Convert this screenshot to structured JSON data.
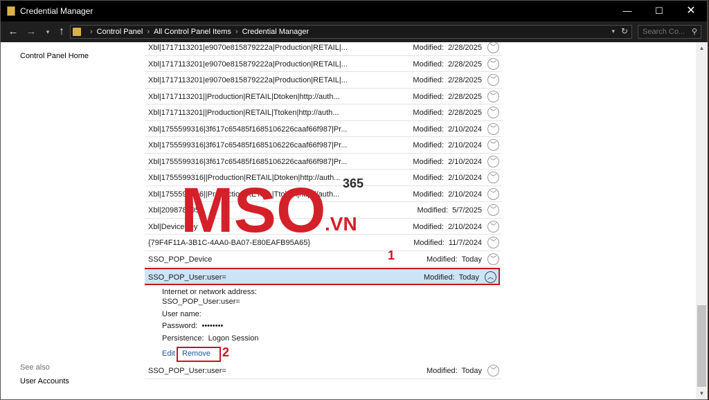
{
  "window": {
    "title": "Credential Manager",
    "controls": {
      "minimize": "—",
      "maximize": "☐",
      "close": "✕"
    }
  },
  "address": {
    "crumbs": [
      "Control Panel",
      "All Control Panel Items",
      "Credential Manager"
    ],
    "search_placeholder": "Search Co..."
  },
  "leftnav": {
    "home": "Control Panel Home",
    "see_also": "See also",
    "user_accounts": "User Accounts"
  },
  "list": {
    "modified_label": "Modified:",
    "items": [
      {
        "name": "Xbl|1717113201|e9070e815879222a|Production|RETAIL|...",
        "date": "2/28/2025"
      },
      {
        "name": "Xbl|1717113201|e9070e815879222a|Production|RETAIL|...",
        "date": "2/28/2025"
      },
      {
        "name": "Xbl|1717113201|e9070e815879222a|Production|RETAIL|...",
        "date": "2/28/2025"
      },
      {
        "name": "Xbl|1717113201||Production|RETAIL|Dtoken|http://auth...",
        "date": "2/28/2025"
      },
      {
        "name": "Xbl|1717113201||Production|RETAIL|Ttoken|http://auth...",
        "date": "2/28/2025"
      },
      {
        "name": "Xbl|1755599316|3f617c65485f1685106226caaf66f987|Pr...",
        "date": "2/10/2024"
      },
      {
        "name": "Xbl|1755599316|3f617c65485f1685106226caaf66f987|Pr...",
        "date": "2/10/2024"
      },
      {
        "name": "Xbl|1755599316|3f617c65485f1685106226caaf66f987|Pr...",
        "date": "2/10/2024"
      },
      {
        "name": "Xbl|1755599316||Production|RETAIL|Dtoken|http://auth...",
        "date": "2/10/2024"
      },
      {
        "name": "Xbl|1755599316||Production|RETAIL|Ttoken|http://auth...",
        "date": "2/10/2024"
      },
      {
        "name": "Xbl|2098787952",
        "date": "5/7/2025"
      },
      {
        "name": "Xbl|DeviceKey",
        "date": "2/10/2024"
      },
      {
        "name": "{79F4F11A-3B1C-4AA0-BA07-E80EAFB95A65}",
        "date": "11/7/2024"
      },
      {
        "name": "SSO_POP_Device",
        "date": "Today"
      }
    ],
    "selected": {
      "name": "SSO_POP_User:user=",
      "date": "Today"
    },
    "last": {
      "name": "SSO_POP_User:user=",
      "date": "Today"
    }
  },
  "details": {
    "address_label": "Internet or network address:",
    "address_value": "SSO_POP_User:user=",
    "username_label": "User name:",
    "password_label": "Password:",
    "password_value": "••••••••",
    "persistence_label": "Persistence:",
    "persistence_value": "Logon Session",
    "edit": "Edit",
    "remove": "Remove"
  },
  "annotations": {
    "one": "1",
    "two": "2"
  },
  "watermark": {
    "brand": "MSO",
    "domain": ".VN",
    "number": "365"
  },
  "colors": {
    "accent_red": "#c8141e",
    "selected_bg": "#cce4f7",
    "link": "#1a57a0"
  }
}
